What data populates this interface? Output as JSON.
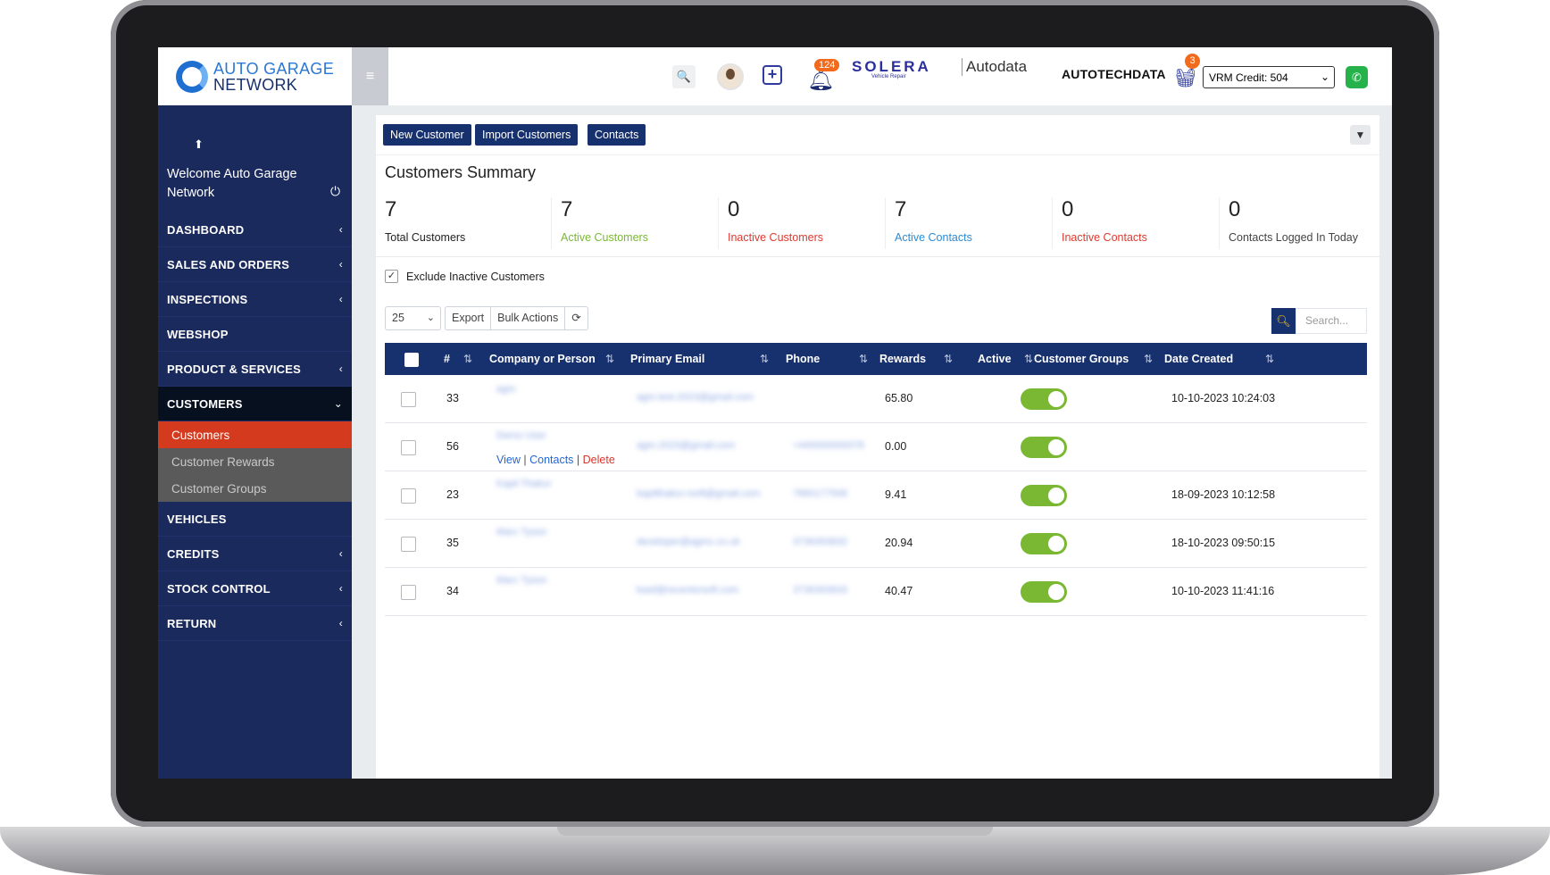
{
  "header": {
    "logo_line1": "AUTO GARAGE",
    "logo_line2": "NETWORK",
    "notification_count": "124",
    "solera": "SOLERA",
    "solera_sub": "Vehicle Repair",
    "autodata": "Autodata",
    "autotechdata": "AUTOTECHDATA",
    "cart_count": "3",
    "vrm_credit": "VRM Credit: 504"
  },
  "sidebar": {
    "welcome": "Welcome Auto Garage Network",
    "items": [
      {
        "label": "DASHBOARD",
        "chev": "‹"
      },
      {
        "label": "SALES AND ORDERS",
        "chev": "‹"
      },
      {
        "label": "INSPECTIONS",
        "chev": "‹"
      },
      {
        "label": "WEBSHOP",
        "chev": ""
      },
      {
        "label": "PRODUCT & SERVICES",
        "chev": "‹"
      },
      {
        "label": "CUSTOMERS",
        "chev": "⌄"
      },
      {
        "label": "VEHICLES",
        "chev": ""
      },
      {
        "label": "CREDITS",
        "chev": "‹"
      },
      {
        "label": "STOCK CONTROL",
        "chev": "‹"
      },
      {
        "label": "RETURN",
        "chev": "‹"
      }
    ],
    "sub_items": [
      "Customers",
      "Customer Rewards",
      "Customer Groups"
    ]
  },
  "actions": {
    "new_customer": "New Customer",
    "import_customers": "Import Customers",
    "contacts": "Contacts"
  },
  "summary": {
    "title": "Customers Summary",
    "stats": [
      {
        "value": "7",
        "label": "Total Customers",
        "color": "#222222"
      },
      {
        "value": "7",
        "label": "Active Customers",
        "color": "#7ab833"
      },
      {
        "value": "0",
        "label": "Inactive Customers",
        "color": "#e0392f"
      },
      {
        "value": "7",
        "label": "Active Contacts",
        "color": "#2a8bd6"
      },
      {
        "value": "0",
        "label": "Inactive Contacts",
        "color": "#e0392f"
      },
      {
        "value": "0",
        "label": "Contacts Logged In Today",
        "color": "#444444"
      }
    ]
  },
  "filter": {
    "exclude_inactive": "Exclude Inactive Customers"
  },
  "toolbar": {
    "page_size": "25",
    "export": "Export",
    "bulk_actions": "Bulk Actions",
    "search_placeholder": "Search..."
  },
  "table": {
    "columns": [
      "#",
      "Company or Person",
      "Primary Email",
      "Phone",
      "Rewards",
      "Active",
      "Customer Groups",
      "Date Created"
    ],
    "rows": [
      {
        "id": "33",
        "company": "agm",
        "email": "agm.test.2023@gmail.com",
        "phone": "",
        "rewards": "65.80",
        "active": true,
        "date": "10-10-2023 10:24:03"
      },
      {
        "id": "56",
        "company": "Demo User",
        "email": "agm.2023@gmail.com",
        "phone": "+440000000078",
        "rewards": "0.00",
        "active": true,
        "date": ""
      },
      {
        "id": "23",
        "company": "Kapil Thakur",
        "email": "kapilthakur.rsoft@gmail.com",
        "phone": "7860177506",
        "rewards": "9.41",
        "active": true,
        "date": "18-09-2023 10:12:58"
      },
      {
        "id": "35",
        "company": "Marc Tyson",
        "email": "developer@agmc.co.uk",
        "phone": "3736393832",
        "rewards": "20.94",
        "active": true,
        "date": "18-10-2023 09:50:15"
      },
      {
        "id": "34",
        "company": "Marc Tyson",
        "email": "kasil@recentsrsoft.com",
        "phone": "3736393833",
        "rewards": "40.47",
        "active": true,
        "date": "10-10-2023 11:41:16"
      }
    ],
    "row_links": {
      "view": "View",
      "contacts": "Contacts",
      "delete": "Delete",
      "sep": "|"
    }
  }
}
